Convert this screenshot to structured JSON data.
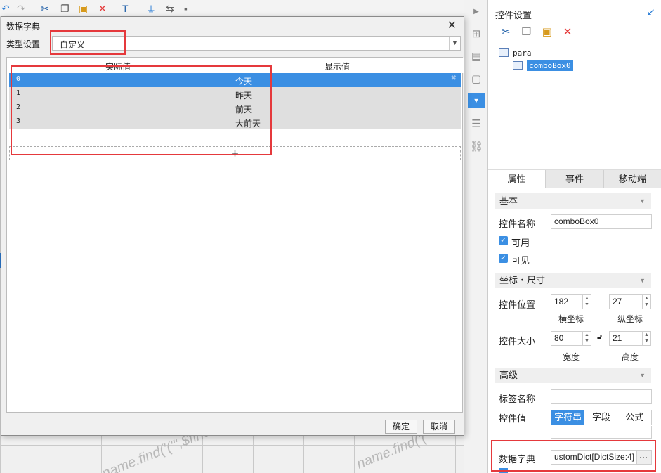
{
  "background": {
    "watermark_left": "name.find('('\",$find...",
    "watermark_right": "name.find('('"
  },
  "dialog": {
    "title": "数据字典",
    "close_glyph": "✕",
    "type_label": "类型设置",
    "type_value": "自定义",
    "columns": [
      "实际值",
      "显示值"
    ],
    "rows": [
      {
        "actual": "0",
        "display": "今天",
        "delete_glyph": "✖"
      },
      {
        "actual": "1",
        "display": "昨天"
      },
      {
        "actual": "2",
        "display": "前天"
      },
      {
        "actual": "3",
        "display": "大前天"
      }
    ],
    "add_glyph": "+",
    "ok_label": "确定",
    "cancel_label": "取消"
  },
  "right_panel": {
    "title": "控件设置",
    "tree": {
      "root": "para",
      "child": "comboBox0"
    },
    "tabs": [
      "属性",
      "事件",
      "移动端"
    ],
    "sections": {
      "basic": "基本",
      "position_size": "坐标・尺寸",
      "advanced": "高级"
    },
    "control_name_label": "控件名称",
    "control_name_value": "comboBox0",
    "enabled_label": "可用",
    "visible_label": "可见",
    "position_label": "控件位置",
    "x_value": "182",
    "y_value": "27",
    "x_label": "横坐标",
    "y_label": "纵坐标",
    "size_label": "控件大小",
    "width_value": "80",
    "height_value": "21",
    "width_label": "宽度",
    "height_label": "高度",
    "tag_name_label": "标签名称",
    "control_value_label": "控件值",
    "value_types": [
      "字符串",
      "字段",
      "公式"
    ],
    "dict_label": "数据字典",
    "dict_value": "ustomDict[DictSize:4]",
    "dict_button": "···"
  },
  "icons": {
    "toolbar": [
      "undo-icon",
      "redo-icon",
      "cut-icon",
      "copy-icon",
      "paste-icon",
      "delete-icon",
      "text-widget-icon",
      "plug-icon",
      "swap-icon",
      "settings-icon"
    ],
    "strip": [
      "layout-icon",
      "widget-icon",
      "frame-icon",
      "combo-icon",
      "list-icon",
      "link-icon"
    ]
  },
  "colors": {
    "accent": "#3b8fe3",
    "highlight_box": "#e5393c"
  }
}
